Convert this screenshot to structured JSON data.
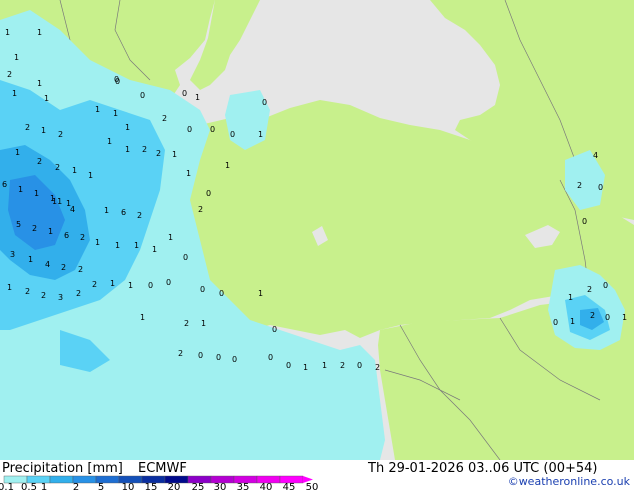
{
  "header": {
    "title": "Precipitation [mm]",
    "model": "ECMWF",
    "valid_time": "Th 29-01-2026 03..06 UTC (00+54)",
    "credit": "©weatheronline.co.uk"
  },
  "colors": {
    "sea": "#e6e6e6",
    "land": "#c8f08c",
    "border": "#7a7a7a",
    "scale": [
      "#a0f0f0",
      "#5ad2f5",
      "#32afeb",
      "#2891e6",
      "#1e6ed2",
      "#1450b9",
      "#0a2ea0",
      "#000a8c",
      "#8c00c8",
      "#b400d2",
      "#d200e1",
      "#f000f0",
      "#ff00ff"
    ]
  },
  "legend": {
    "ticks": [
      "0.1",
      "0.5",
      "1",
      "2",
      "5",
      "10",
      "15",
      "20",
      "25",
      "30",
      "35",
      "40",
      "45",
      "50"
    ]
  },
  "values": [
    "1",
    "1",
    "1",
    "2",
    "1",
    "1",
    "1",
    "0",
    "1",
    "1",
    "2",
    "2",
    "1",
    "2",
    "1",
    "1",
    "2",
    "2",
    "1",
    "1",
    "1",
    "1",
    "2",
    "2",
    "1",
    "6",
    "1",
    "1",
    "1",
    "1",
    "11",
    "4",
    "1",
    "6",
    "2",
    "5",
    "2",
    "1",
    "6",
    "2",
    "3",
    "1",
    "4",
    "2",
    "2",
    "1",
    "1",
    "1",
    "1",
    "1",
    "1",
    "2",
    "2",
    "3",
    "2",
    "2",
    "1",
    "1",
    "0",
    "0",
    "1",
    "0",
    "0",
    "0",
    "2",
    "0",
    "0",
    "0",
    "0",
    "1",
    "0",
    "1",
    "1",
    "0",
    "0",
    "0",
    "1",
    "1",
    "2",
    "1",
    "0",
    "2",
    "0",
    "0",
    "0",
    "0",
    "0",
    "1",
    "1",
    "2",
    "0",
    "2",
    "4",
    "2",
    "0",
    "0",
    "0",
    "2",
    "1",
    "0",
    "1",
    "2",
    "0",
    "1"
  ]
}
